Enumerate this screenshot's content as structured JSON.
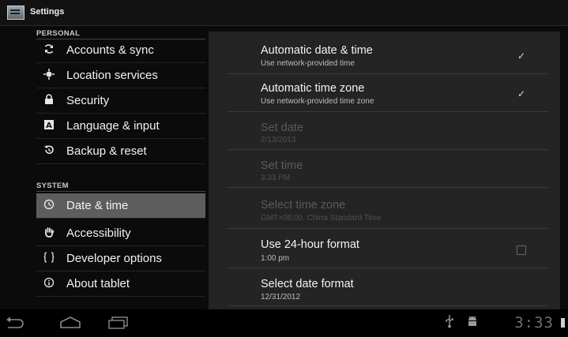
{
  "app": {
    "title": "Settings",
    "icon": "settings-app-icon"
  },
  "sidebar": {
    "categories": [
      "PERSONAL",
      "SYSTEM"
    ],
    "items": [
      {
        "label": "Accounts & sync",
        "icon": "sync-icon"
      },
      {
        "label": "Location services",
        "icon": "location-icon"
      },
      {
        "label": "Security",
        "icon": "lock-icon"
      },
      {
        "label": "Language & input",
        "icon": "keyboard-icon"
      },
      {
        "label": "Backup & reset",
        "icon": "backup-icon"
      },
      {
        "label": "Date & time",
        "icon": "clock-icon",
        "selected": true
      },
      {
        "label": "Accessibility",
        "icon": "hand-icon"
      },
      {
        "label": "Developer options",
        "icon": "braces-icon"
      },
      {
        "label": "About tablet",
        "icon": "info-icon"
      }
    ]
  },
  "detail": {
    "prefs": [
      {
        "title": "Automatic date & time",
        "summary": "Use network-provided time",
        "checked": true,
        "enabled": true
      },
      {
        "title": "Automatic time zone",
        "summary": "Use network-provided time zone",
        "checked": true,
        "enabled": true
      },
      {
        "title": "Set date",
        "summary": "2/13/2013",
        "enabled": false
      },
      {
        "title": "Set time",
        "summary": "3:33 PM",
        "enabled": false
      },
      {
        "title": "Select time zone",
        "summary": "GMT+08:00, China Standard Time",
        "enabled": false
      },
      {
        "title": "Use 24-hour format",
        "summary": "1:00 pm",
        "checked": false,
        "enabled": true
      },
      {
        "title": "Select date format",
        "summary": "12/31/2012",
        "enabled": true
      }
    ]
  },
  "navbar": {
    "buttons": [
      "back-icon",
      "home-icon",
      "recent-apps-icon"
    ],
    "status": {
      "usb": "usb-icon",
      "debug": "android-debug-icon",
      "time": "3:33",
      "battery": "battery-icon"
    }
  },
  "colors": {
    "selected_row": "#5d5d5d",
    "pane": "#242424",
    "background": "#0b0b0b"
  }
}
